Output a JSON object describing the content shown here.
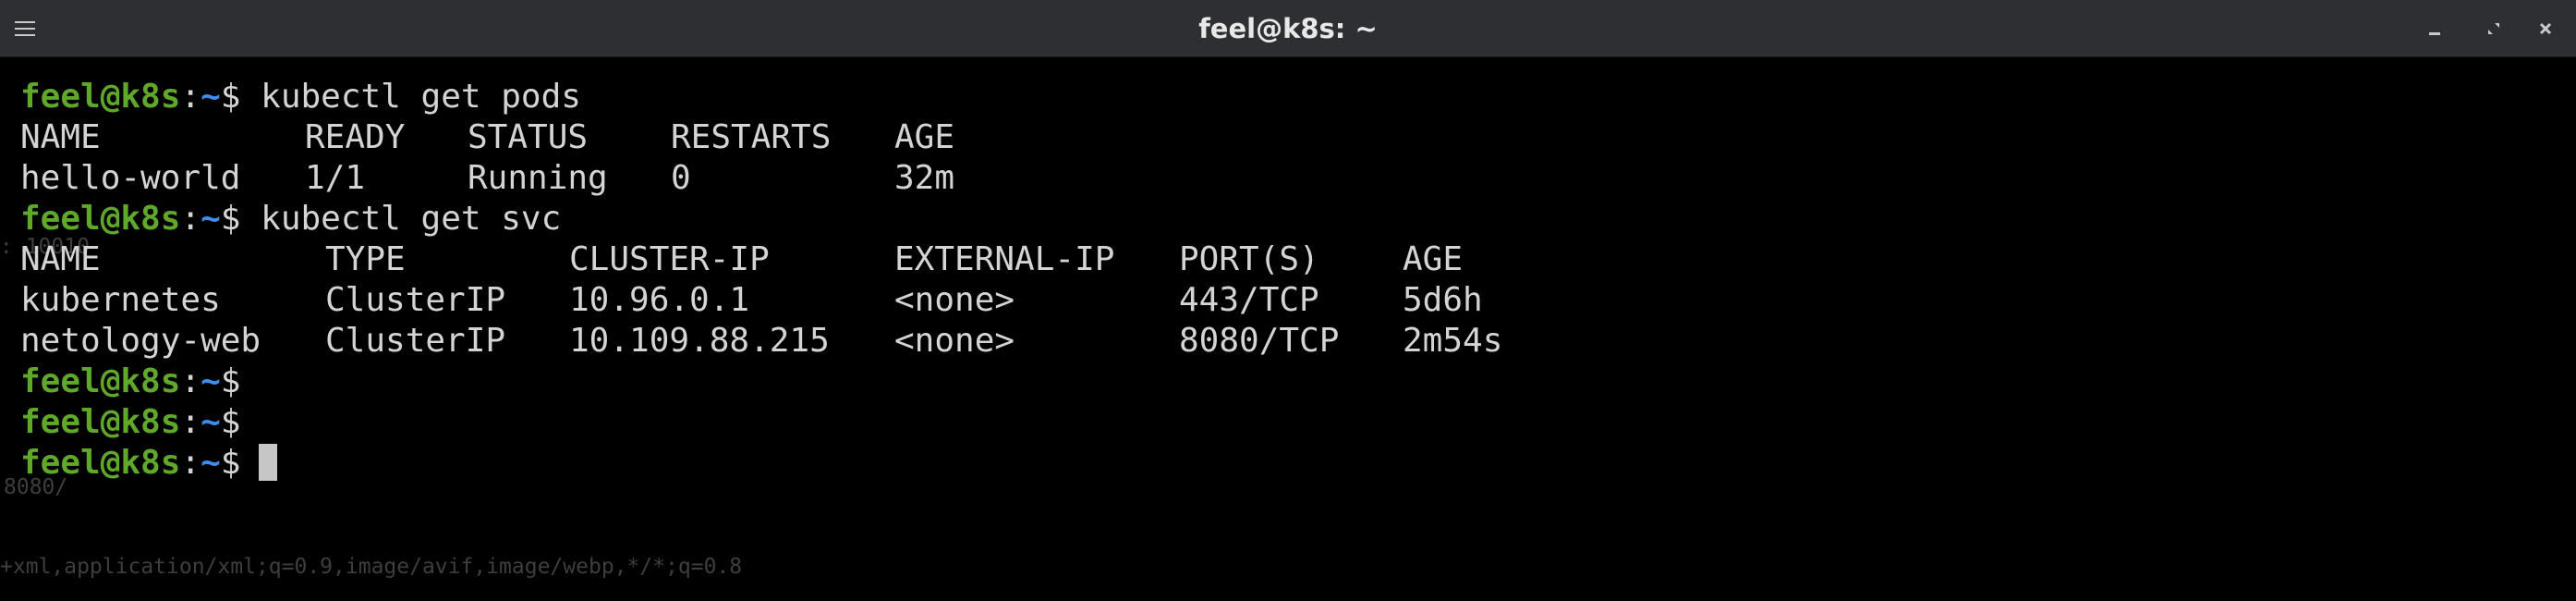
{
  "window": {
    "title": "feel@k8s: ~"
  },
  "prompt": {
    "user_host": "feel@k8s",
    "colon": ":",
    "path": "~",
    "sign": "$"
  },
  "commands": {
    "get_pods": "kubectl get pods",
    "get_svc": "kubectl get svc"
  },
  "pods_table": {
    "headers": [
      "NAME",
      "READY",
      "STATUS",
      "RESTARTS",
      "AGE"
    ],
    "rows": [
      [
        "hello-world",
        "1/1",
        "Running",
        "0",
        "32m"
      ]
    ]
  },
  "svc_table": {
    "headers": [
      "NAME",
      "TYPE",
      "CLUSTER-IP",
      "EXTERNAL-IP",
      "PORT(S)",
      "AGE"
    ],
    "rows": [
      [
        "kubernetes",
        "ClusterIP",
        "10.96.0.1",
        "<none>",
        "443/TCP",
        "5d6h"
      ],
      [
        "netology-web",
        "ClusterIP",
        "10.109.88.215",
        "<none>",
        "8080/TCP",
        "2m54s"
      ]
    ]
  },
  "ghost_text": {
    "fragment1": ": 10010",
    "fragment2": "8080/",
    "fragment3": "+xml,application/xml;q=0.9,image/avif,image/webp,*/*;q=0.8"
  },
  "colors": {
    "prompt_user": "#5fa82a",
    "prompt_path": "#3b8eea",
    "text": "#d4d4d4",
    "background": "#000000",
    "titlebar": "#2e2f32"
  }
}
